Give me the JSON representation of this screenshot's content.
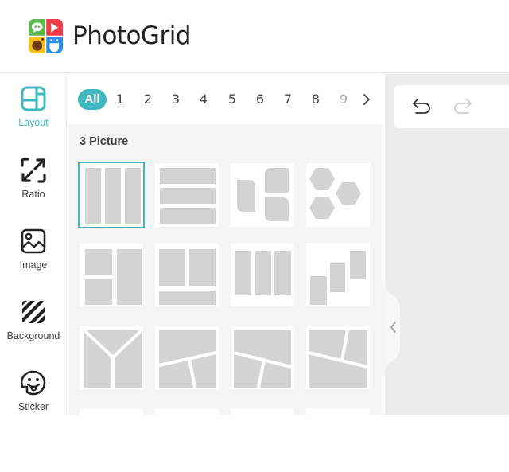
{
  "header": {
    "brand": "PhotoGrid",
    "logo_colors": {
      "green": "#5cb84a",
      "red": "#ee3e4b",
      "yellow": "#f5c01b",
      "blue": "#2f8fe8"
    }
  },
  "sidebar": {
    "items": [
      {
        "label": "Layout",
        "icon": "layout-icon",
        "active": true
      },
      {
        "label": "Ratio",
        "icon": "ratio-expand-icon",
        "active": false
      },
      {
        "label": "Image",
        "icon": "image-icon",
        "active": false
      },
      {
        "label": "Background",
        "icon": "background-stripes-icon",
        "active": false
      },
      {
        "label": "Sticker",
        "icon": "sticker-icon",
        "active": false
      }
    ]
  },
  "panel": {
    "tabs": [
      "All",
      "1",
      "2",
      "3",
      "4",
      "5",
      "6",
      "7",
      "8",
      "9"
    ],
    "active_tab": "All",
    "next_icon": "chevron-right-icon",
    "section_title": "3 Picture",
    "templates": [
      {
        "name": "three-columns",
        "selected": true
      },
      {
        "name": "three-rows",
        "selected": false
      },
      {
        "name": "rounded-three",
        "selected": false
      },
      {
        "name": "three-hexagons",
        "selected": false
      },
      {
        "name": "two-left-one-right",
        "selected": false
      },
      {
        "name": "two-top-one-bottom",
        "selected": false
      },
      {
        "name": "three-columns-short",
        "selected": false
      },
      {
        "name": "staircase",
        "selected": false
      },
      {
        "name": "y-split",
        "selected": false
      },
      {
        "name": "tilted-top-split",
        "selected": false
      },
      {
        "name": "tilted-bottom-split",
        "selected": false
      },
      {
        "name": "tilted-top-right-split",
        "selected": false
      }
    ]
  },
  "canvas": {
    "undo_icon": "undo-icon",
    "redo_icon": "redo-icon",
    "collapse_icon": "chevron-left-icon"
  },
  "colors": {
    "accent": "#3fb8c0",
    "placeholder": "#d3d3d3"
  }
}
